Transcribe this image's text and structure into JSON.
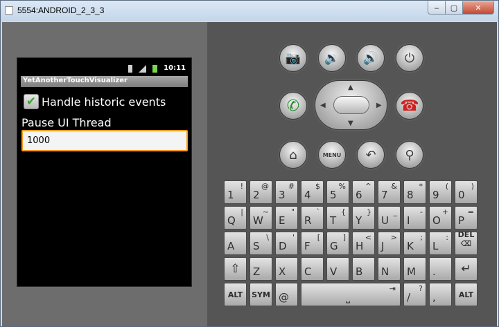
{
  "window": {
    "title": "5554:ANDROID_2_3_3",
    "minimize": "‒",
    "maximize": "▢",
    "close": "✕"
  },
  "status": {
    "time": "10:11"
  },
  "app": {
    "title": "YetAnotherTouchVisualizer",
    "checkbox_label": "Handle historic events",
    "checkbox_checked": true,
    "checkmark": "✔",
    "pause_label": "Pause UI Thread",
    "pause_value": "1000"
  },
  "controls": {
    "menu_label": "MENU",
    "icons": {
      "camera": "📷",
      "vol_down": "🔉",
      "vol_up": "🔊",
      "power": "⏻",
      "call": "✆",
      "end": "☎",
      "home": "⌂",
      "back": "↶",
      "search": "⚲",
      "up": "▲",
      "down": "▼",
      "left": "◀",
      "right": "▶"
    }
  },
  "keyboard": {
    "rows": [
      [
        {
          "main": "1",
          "alt": "!"
        },
        {
          "main": "2",
          "alt": "@"
        },
        {
          "main": "3",
          "alt": "#"
        },
        {
          "main": "4",
          "alt": "$"
        },
        {
          "main": "5",
          "alt": "%"
        },
        {
          "main": "6",
          "alt": "^"
        },
        {
          "main": "7",
          "alt": "&"
        },
        {
          "main": "8",
          "alt": "*"
        },
        {
          "main": "9",
          "alt": "("
        },
        {
          "main": "0",
          "alt": ")"
        }
      ],
      [
        {
          "main": "Q",
          "alt": "|"
        },
        {
          "main": "W",
          "alt": "~"
        },
        {
          "main": "E",
          "alt": "\""
        },
        {
          "main": "R",
          "alt": "`"
        },
        {
          "main": "T",
          "alt": "{"
        },
        {
          "main": "Y",
          "alt": "}"
        },
        {
          "main": "U",
          "alt": "_"
        },
        {
          "main": "I",
          "alt": "-"
        },
        {
          "main": "O",
          "alt": "+"
        },
        {
          "main": "P",
          "alt": "="
        }
      ],
      [
        {
          "main": "A",
          "alt": ""
        },
        {
          "main": "S",
          "alt": "\\"
        },
        {
          "main": "D",
          "alt": "'"
        },
        {
          "main": "F",
          "alt": "["
        },
        {
          "main": "G",
          "alt": "]"
        },
        {
          "main": "H",
          "alt": "<"
        },
        {
          "main": "J",
          "alt": ">"
        },
        {
          "main": "K",
          "alt": ";"
        },
        {
          "main": "L",
          "alt": ":"
        },
        {
          "small": "DEL ⌫"
        }
      ],
      [
        {
          "sym": "⇧"
        },
        {
          "main": "Z",
          "alt": ""
        },
        {
          "main": "X",
          "alt": ""
        },
        {
          "main": "C",
          "alt": ""
        },
        {
          "main": "V",
          "alt": ""
        },
        {
          "main": "B",
          "alt": ""
        },
        {
          "main": "N",
          "alt": ""
        },
        {
          "main": "M",
          "alt": ""
        },
        {
          "main": ".",
          "alt": ""
        },
        {
          "sym": "↵"
        }
      ]
    ],
    "bottom": {
      "alt_left": "ALT",
      "sym": "SYM",
      "at": "@",
      "space_arrow": "⇥",
      "space": "⎵",
      "slash": "/",
      "question": "?",
      "comma": ",",
      "alt_right": "ALT"
    }
  }
}
